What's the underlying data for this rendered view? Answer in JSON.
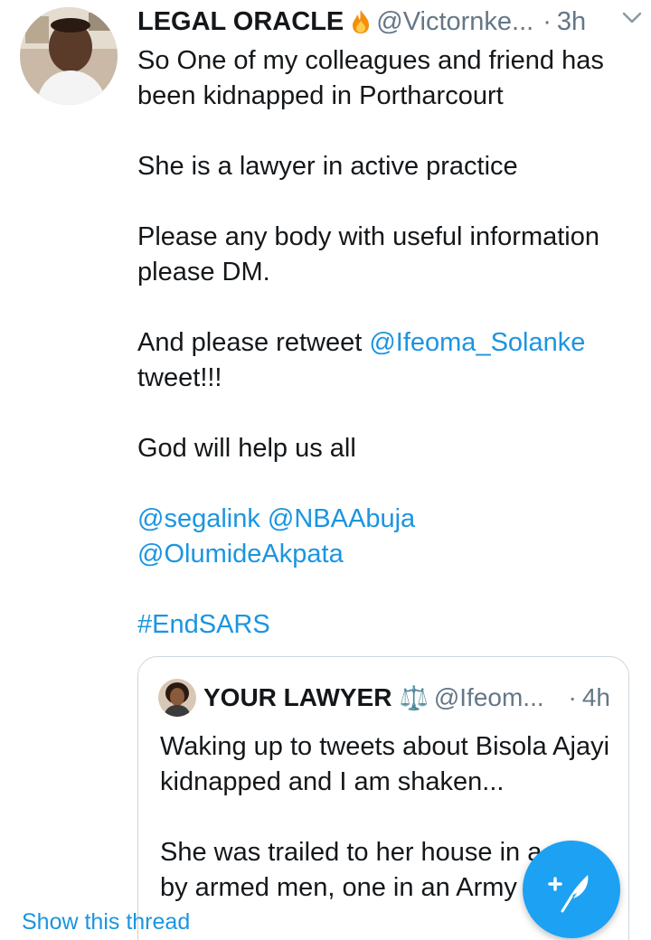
{
  "tweet": {
    "display_name": "LEGAL ORACLE",
    "handle": "@Victornke...",
    "separator": "·",
    "time": "3h",
    "icons": {
      "fire": "fire-emoji-icon",
      "caret": "chevron-down-icon"
    },
    "paragraphs": [
      "So One of my colleagues and friend has been kidnapped in Portharcourt",
      "She is a lawyer in active practice",
      "Please any body with useful information please DM."
    ],
    "retweet_line_prefix": "And please retweet",
    "retweet_mention": "@Ifeoma_Solanke",
    "retweet_line_suffix": "tweet!!!",
    "closing": "God will help us all",
    "mentions": [
      "@segalink",
      "@NBAAbuja",
      "@OlumideAkpata"
    ],
    "hashtag": "#EndSARS"
  },
  "quoted": {
    "display_name": "YOUR LAWYER",
    "scales_icon": "⚖️",
    "handle": "@Ifeom...",
    "separator": "·",
    "time": "4h",
    "paragraphs": [
      "Waking up to tweets about Bisola Ajayi kidnapped and I am shaken...",
      "She was trailed to her house in a car by armed men, one in an Army"
    ],
    "show_thread": "Show this thread"
  },
  "fab": {
    "icon": "compose-feather-icon"
  },
  "colors": {
    "link": "#1b95e0",
    "fab": "#1da1f2",
    "muted": "#657786",
    "border": "#ccd6dd"
  }
}
